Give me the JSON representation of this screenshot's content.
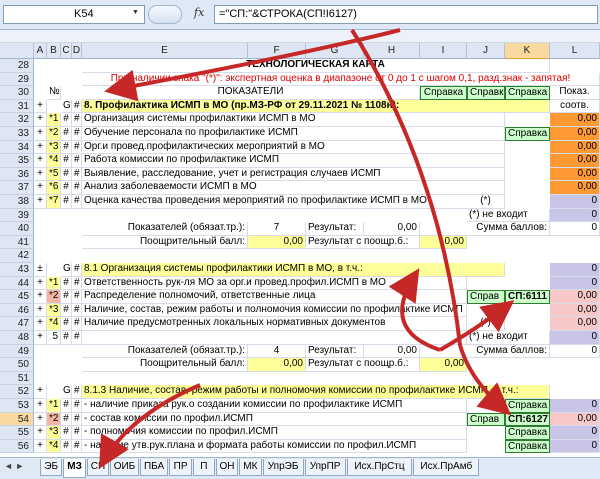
{
  "formula_bar": {
    "name_box": "K54",
    "fx": "fx",
    "formula": "=\"СП:\"&СТРОКА(СП!I6127)"
  },
  "columns": [
    "A",
    "B",
    "C",
    "D",
    "E",
    "F",
    "G",
    "H",
    "I",
    "J",
    "K",
    "L"
  ],
  "row_headers": [
    "28",
    "29",
    "30",
    "31",
    "32",
    "33",
    "34",
    "35",
    "36",
    "37",
    "38",
    "39",
    "40",
    "41",
    "42",
    "43",
    "44",
    "45",
    "46",
    "47",
    "48",
    "49",
    "50",
    "51",
    "52",
    "53",
    "54",
    "55",
    "56"
  ],
  "active_row": "54",
  "active_col": "K",
  "sheet": {
    "title": "ТЕХНОЛОГИЧЕСКАЯ КАРТА",
    "note": "При наличии знака \"(*)\": экспертная оценка в диапазоне от 0 до 1 с шагом 0,1, разд.знак - запятая!",
    "hdr_no": "№",
    "hdr_indicators": "ПОКАЗАТЕЛИ",
    "hdr_ref": "Справка",
    "hdr_ref_short": "Справ",
    "hdr_value_1": "Показ.",
    "hdr_value_2": "соотв.",
    "s8_title": "8. Профилактика ИСМП в МО  (пр.МЗ-РФ от 29.11.2021 № 1108н):",
    "items": [
      {
        "num": "*1",
        "text": "Организация системы профилактики ИСМП в МО",
        "val": "0,00"
      },
      {
        "num": "*2",
        "text": "Обучение персонала по профилактике ИСМП",
        "val": "0,00"
      },
      {
        "num": "*3",
        "text": "Орг.и провед.профилактических мероприятий в МО",
        "val": "0,00"
      },
      {
        "num": "*4",
        "text": "Работа комиссии по профилактике ИСМП",
        "val": "0,00"
      },
      {
        "num": "*5",
        "text": "Выявление, расследование, учет и регистрация случаев ИСМП",
        "val": "0,00"
      },
      {
        "num": "*6",
        "text": "Анализ заболеваемости ИСМП в МО",
        "val": "0,00"
      },
      {
        "num": "*7",
        "text": "Оценка качества проведения мероприятий по профилактике ИСМП в МО",
        "val": "0"
      }
    ],
    "star_mark": "(*)",
    "not_included": "(*) не входит",
    "zero": "0",
    "z00": "0,00",
    "sum_label": "Сумма баллов:",
    "ind_label": "Показателей (обязат.тр.):",
    "ind_count": "7",
    "result_label": "Результат:",
    "bonus_label": "Поощрительный балл:",
    "bonus_result_label": "Результат с поощр.б.:",
    "s81_title": "8.1 Организация системы профилактики ИСМП в МО, в т.ч.:",
    "items81": [
      {
        "num": "*1",
        "text": "Ответственность рук-ля МО за орг.и провед.профил.ИСМП в МО",
        "val": "0"
      },
      {
        "num": "*2",
        "text": "Распределение полномочий, ответственные лица",
        "val": "0,00",
        "ref": "СП:6111"
      },
      {
        "num": "*3",
        "text": "Наличие, состав, режим работы и полномочия комиссии по профилактике ИСМП",
        "val": "0,00"
      },
      {
        "num": "*4",
        "text": "Наличие предусмотренных локальных нормативных документов",
        "val": "0,00"
      },
      {
        "num": "5",
        "text": "",
        "val": ""
      }
    ],
    "ind_count_81": "4",
    "s813_title": "8.1.3 Наличие, состав, режим работы и полномочия комиссии по профилактике ИСМП, в т.ч.:",
    "items813": [
      {
        "num": "*1",
        "text": "- наличие приказа рук.о создании комиссии по профилактике ИСМП",
        "val": "0"
      },
      {
        "num": "*2",
        "text": "- состав комиссии по профил.ИСМП",
        "val": "0,00",
        "ref": "СП:6127"
      },
      {
        "num": "*3",
        "text": "- полномочия комиссии по профил.ИСМП",
        "val": "0"
      },
      {
        "num": "*4",
        "text": "- наличие утв.рук.плана и формата работы комиссии по профил.ИСМП",
        "val": "0"
      }
    ],
    "marks": {
      "plus": "+",
      "pm": "±",
      "hash": "#",
      "g": "G"
    }
  },
  "tabs": [
    "ЭБ",
    "МЗ",
    "СП",
    "ОИБ",
    "ПБА",
    "ПР",
    "П",
    "ОН",
    "МК",
    "УпрЭБ",
    "УпрПР",
    "Исх.ПрСтц",
    "Исх.ПрАмб"
  ],
  "active_tab": "МЗ",
  "colors": {
    "arrow": "#c62828",
    "yellow": "#ffff99",
    "green": "#ccffcc",
    "orange": "#ff9933"
  }
}
